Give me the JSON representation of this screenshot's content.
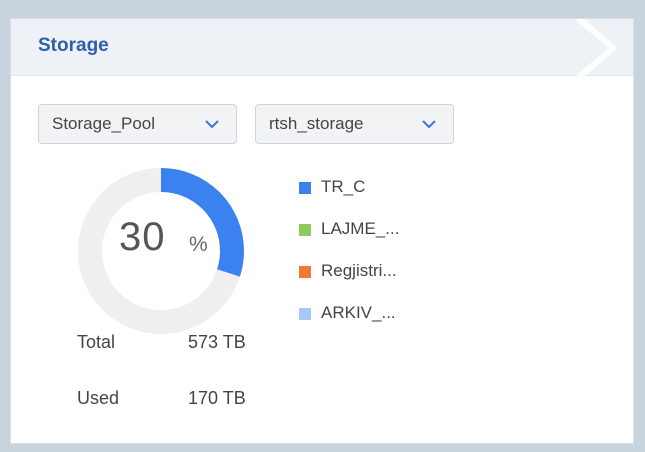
{
  "panel": {
    "title": "Storage"
  },
  "filters": {
    "pool_select": {
      "value": "Storage_Pool"
    },
    "storage_select": {
      "value": "rtsh_storage"
    }
  },
  "usage": {
    "percent": "30",
    "unit": "%",
    "fraction": 0.3,
    "color": "#3b82f0",
    "track_color": "#efefef"
  },
  "legend": [
    {
      "label": "TR_C",
      "color": "#3b82f0"
    },
    {
      "label": "LAJME_...",
      "color": "#8ccb5e"
    },
    {
      "label": "Regjistri...",
      "color": "#f47c30"
    },
    {
      "label": "ARKIV_...",
      "color": "#a9c7f5"
    }
  ],
  "stats": {
    "total_label": "Total",
    "total_value": "573 TB",
    "used_label": "Used",
    "used_value": "170 TB"
  }
}
